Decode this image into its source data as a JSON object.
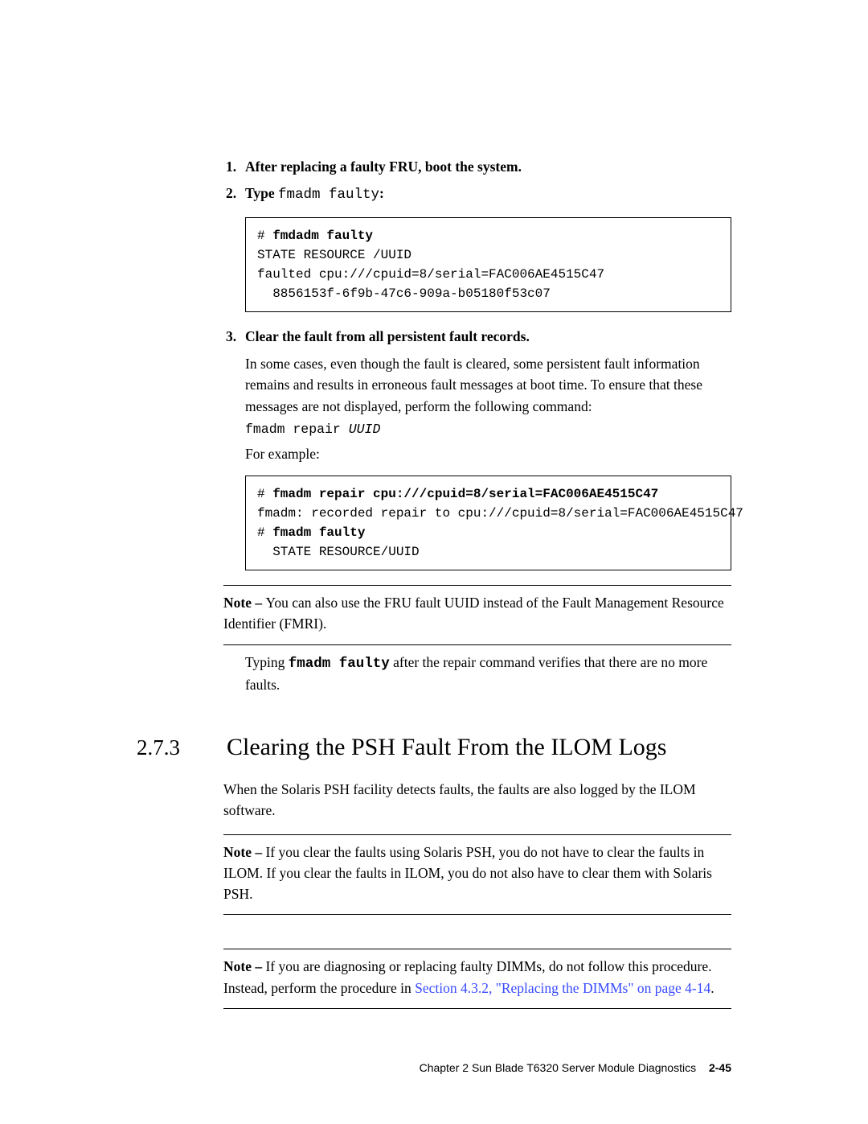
{
  "steps": {
    "s1": {
      "num": "1.",
      "text": "After replacing a faulty FRU, boot the system."
    },
    "s2": {
      "num": "2.",
      "text": "Type ",
      "cmd": "fmadm faulty",
      "tail": ":"
    },
    "s3": {
      "num": "3.",
      "text": "Clear the fault from all persistent fault records."
    }
  },
  "code1": {
    "l1a": "# ",
    "l1b": "fmdadm faulty",
    "l2": "STATE RESOURCE /UUID",
    "l3": "faulted cpu:///cpuid=8/serial=FAC006AE4515C47",
    "l4": "  8856153f-6f9b-47c6-909a-b05180f53c07"
  },
  "para_s3": "In some cases, even though the fault is cleared, some persistent fault information remains and results in erroneous fault messages at boot time. To ensure that these messages are not displayed, perform the following command:",
  "cmd_repair": {
    "a": "fmadm repair ",
    "b": "UUID"
  },
  "for_example": "For example:",
  "code2": {
    "l1a": "# ",
    "l1b": "fmadm repair cpu:///cpuid=8/serial=FAC006AE4515C47",
    "l2": "fmadm: recorded repair to cpu:///cpuid=8/serial=FAC006AE4515C47",
    "l3a": "# ",
    "l3b": "fmadm faulty",
    "l4": "  STATE RESOURCE/UUID"
  },
  "note1": {
    "lead": "Note – ",
    "text": "You can also use the FRU fault UUID instead of the Fault Management Resource Identifier (FMRI)."
  },
  "after_note1_a": "Typing ",
  "after_note1_cmd": "fmadm faulty",
  "after_note1_b": " after the repair command verifies that there are no more faults.",
  "section": {
    "num": "2.7.3",
    "title": "Clearing the PSH Fault From the ILOM Logs"
  },
  "section_intro": "When the Solaris PSH facility detects faults, the faults are also logged by the ILOM software.",
  "note2": {
    "lead": "Note – ",
    "text": "If you clear the faults using Solaris PSH, you do not have to clear the faults in ILOM. If you clear the faults in ILOM, you do not also have to clear them with Solaris PSH."
  },
  "note3": {
    "lead": "Note – ",
    "a": "If you are diagnosing or replacing faulty DIMMs, do not follow this procedure. Instead, perform the procedure in ",
    "link": "Section 4.3.2, \"Replacing the DIMMs\" on page 4-14",
    "b": "."
  },
  "footer": {
    "chapter": "Chapter 2    Sun Blade T6320 Server Module Diagnostics",
    "page": "2-45"
  }
}
